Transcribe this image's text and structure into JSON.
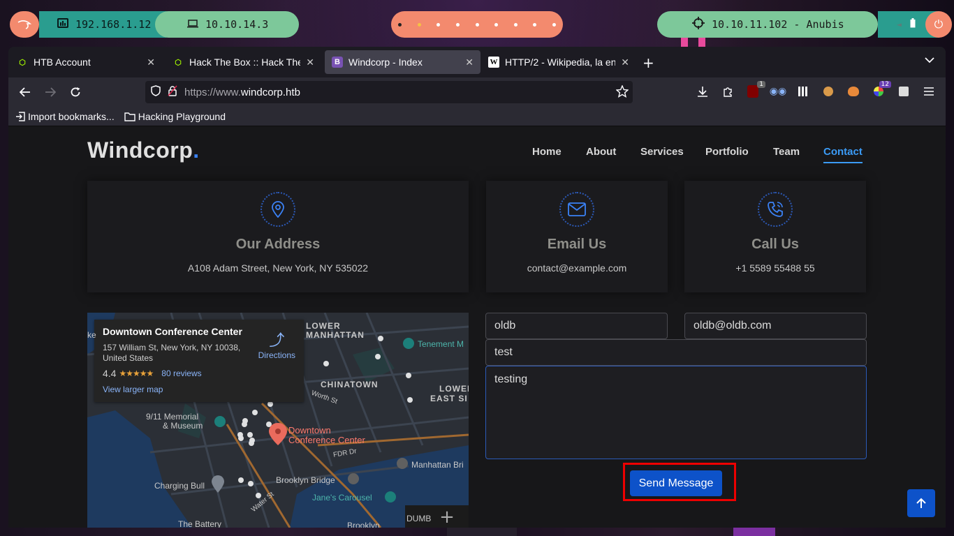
{
  "panel": {
    "local_ip": "192.168.1.12",
    "vpn_ip": "10.10.14.3",
    "target": "10.10.11.102 - Anubis",
    "workspaces": [
      "",
      "",
      "",
      "",
      "",
      "",
      "",
      "",
      ""
    ]
  },
  "browser": {
    "tabs": [
      {
        "label": "HTB Account",
        "favicon": "hexagon-icon"
      },
      {
        "label": "Hack The Box :: Hack The",
        "favicon": "hexagon-icon"
      },
      {
        "label": "Windcorp - Index",
        "favicon": "B"
      },
      {
        "label": "HTTP/2 - Wikipedia, la en",
        "favicon": "W"
      }
    ],
    "url_prefix": "https://www.",
    "url_host": "windcorp.htb",
    "extensions": {
      "ublock_badge": "1",
      "colorzilla_badge": "12"
    },
    "bookmarks": [
      {
        "label": "Import bookmarks..."
      },
      {
        "label": "Hacking Playground"
      }
    ]
  },
  "site": {
    "logo": "Windcorp",
    "logo_dot": ".",
    "nav": [
      "Home",
      "About",
      "Services",
      "Portfolio",
      "Team",
      "Contact"
    ],
    "active_nav": "Contact",
    "cards": [
      {
        "title": "Our Address",
        "text": "A108 Adam Street, New York, NY 535022",
        "icon": "map-pin-icon"
      },
      {
        "title": "Email Us",
        "text": "contact@example.com",
        "icon": "envelope-icon"
      },
      {
        "title": "Call Us",
        "text": "+1 5589 55488 55",
        "icon": "phone-icon"
      }
    ],
    "map": {
      "place": "Downtown Conference Center",
      "address": "157 William St, New York, NY 10038, United States",
      "rating": "4.4",
      "stars": "★★★★★",
      "reviews": "80 reviews",
      "directions": "Directions",
      "larger": "View larger map",
      "labels": {
        "lower_manhattan_1": "LOWER",
        "lower_manhattan_2": "MANHATTAN",
        "chinatown": "CHINATOWN",
        "lower_east_1": "LOWER",
        "lower_east_2": "EAST SI",
        "tenement": "Tenement M",
        "memorial_1": "9/11 Memorial",
        "memorial_2": "& Museum",
        "pin_1": "Downtown",
        "pin_2": "Conference Center",
        "charging_bull": "Charging Bull",
        "brooklyn_bridge": "Brooklyn Bridge",
        "janes_carousel": "Jane's Carousel",
        "manhattan_bridge": "Manhattan Bri",
        "battery": "The Battery",
        "dumbo": "DUMB",
        "fdr": "FDR Dr",
        "worth": "Worth St",
        "water": "Water St",
        "brooklyn": "Brooklyn",
        "ke": "ke"
      }
    },
    "form": {
      "name": "oldb",
      "email": "oldb@oldb.com",
      "subject": "test",
      "message": "testing",
      "submit": "Send Message"
    }
  },
  "colors": {
    "accent": "#3b82f6",
    "button": "#0d52c9",
    "highlight": "#ee0000"
  }
}
